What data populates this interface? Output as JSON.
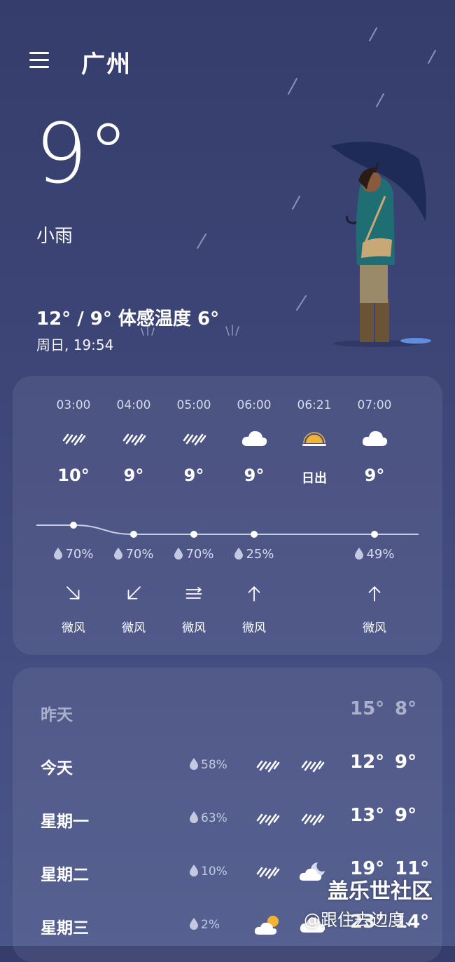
{
  "header": {
    "city": "广州",
    "menu_icon": "menu-icon"
  },
  "current": {
    "temperature": "9°",
    "condition": "小雨",
    "range_feels": "12° / 9° 体感温度 6°",
    "datetime": "周日, 19:54"
  },
  "hourly": [
    {
      "time": "03:00",
      "icon": "light-rain-icon",
      "temp": "10°",
      "pop": "70%",
      "wind_icon": "arrow-down-right-icon",
      "wind": "微风",
      "temp_value": 10
    },
    {
      "time": "04:00",
      "icon": "light-rain-icon",
      "temp": "9°",
      "pop": "70%",
      "wind_icon": "arrow-down-left-icon",
      "wind": "微风",
      "temp_value": 9
    },
    {
      "time": "05:00",
      "icon": "light-rain-icon",
      "temp": "9°",
      "pop": "70%",
      "wind_icon": "variable-wind-icon",
      "wind": "微风",
      "temp_value": 9
    },
    {
      "time": "06:00",
      "icon": "cloudy-icon",
      "temp": "9°",
      "pop": "25%",
      "wind_icon": "arrow-up-icon",
      "wind": "微风",
      "temp_value": 9
    },
    {
      "time": "06:21",
      "icon": "sunrise-icon",
      "temp": "日出",
      "pop": "",
      "wind_icon": "",
      "wind": "",
      "temp_value": null
    },
    {
      "time": "07:00",
      "icon": "cloudy-icon",
      "temp": "9°",
      "pop": "49%",
      "wind_icon": "arrow-up-icon",
      "wind": "微风",
      "temp_value": 9
    }
  ],
  "daily": [
    {
      "day": "昨天",
      "pop": "",
      "icon_day": "",
      "icon_night": "",
      "high": "15°",
      "low": "8°",
      "past": true
    },
    {
      "day": "今天",
      "pop": "58%",
      "icon_day": "light-rain-icon",
      "icon_night": "light-rain-icon",
      "high": "12°",
      "low": "9°"
    },
    {
      "day": "星期一",
      "pop": "63%",
      "icon_day": "light-rain-icon",
      "icon_night": "light-rain-icon",
      "high": "13°",
      "low": "9°"
    },
    {
      "day": "星期二",
      "pop": "10%",
      "icon_day": "light-rain-icon",
      "icon_night": "partly-cloudy-night-icon",
      "high": "19°",
      "low": "11°"
    },
    {
      "day": "星期三",
      "pop": "2%",
      "icon_day": "partly-cloudy-day-icon",
      "icon_night": "cloudy-icon",
      "high": "23°",
      "low": "14°"
    }
  ],
  "watermark": {
    "site": "盖乐世社区",
    "user": "@跟住去边度、"
  },
  "colors": {
    "background_top": "#353d6b",
    "background_bottom": "#4a5589",
    "sun": "#f2b233"
  }
}
